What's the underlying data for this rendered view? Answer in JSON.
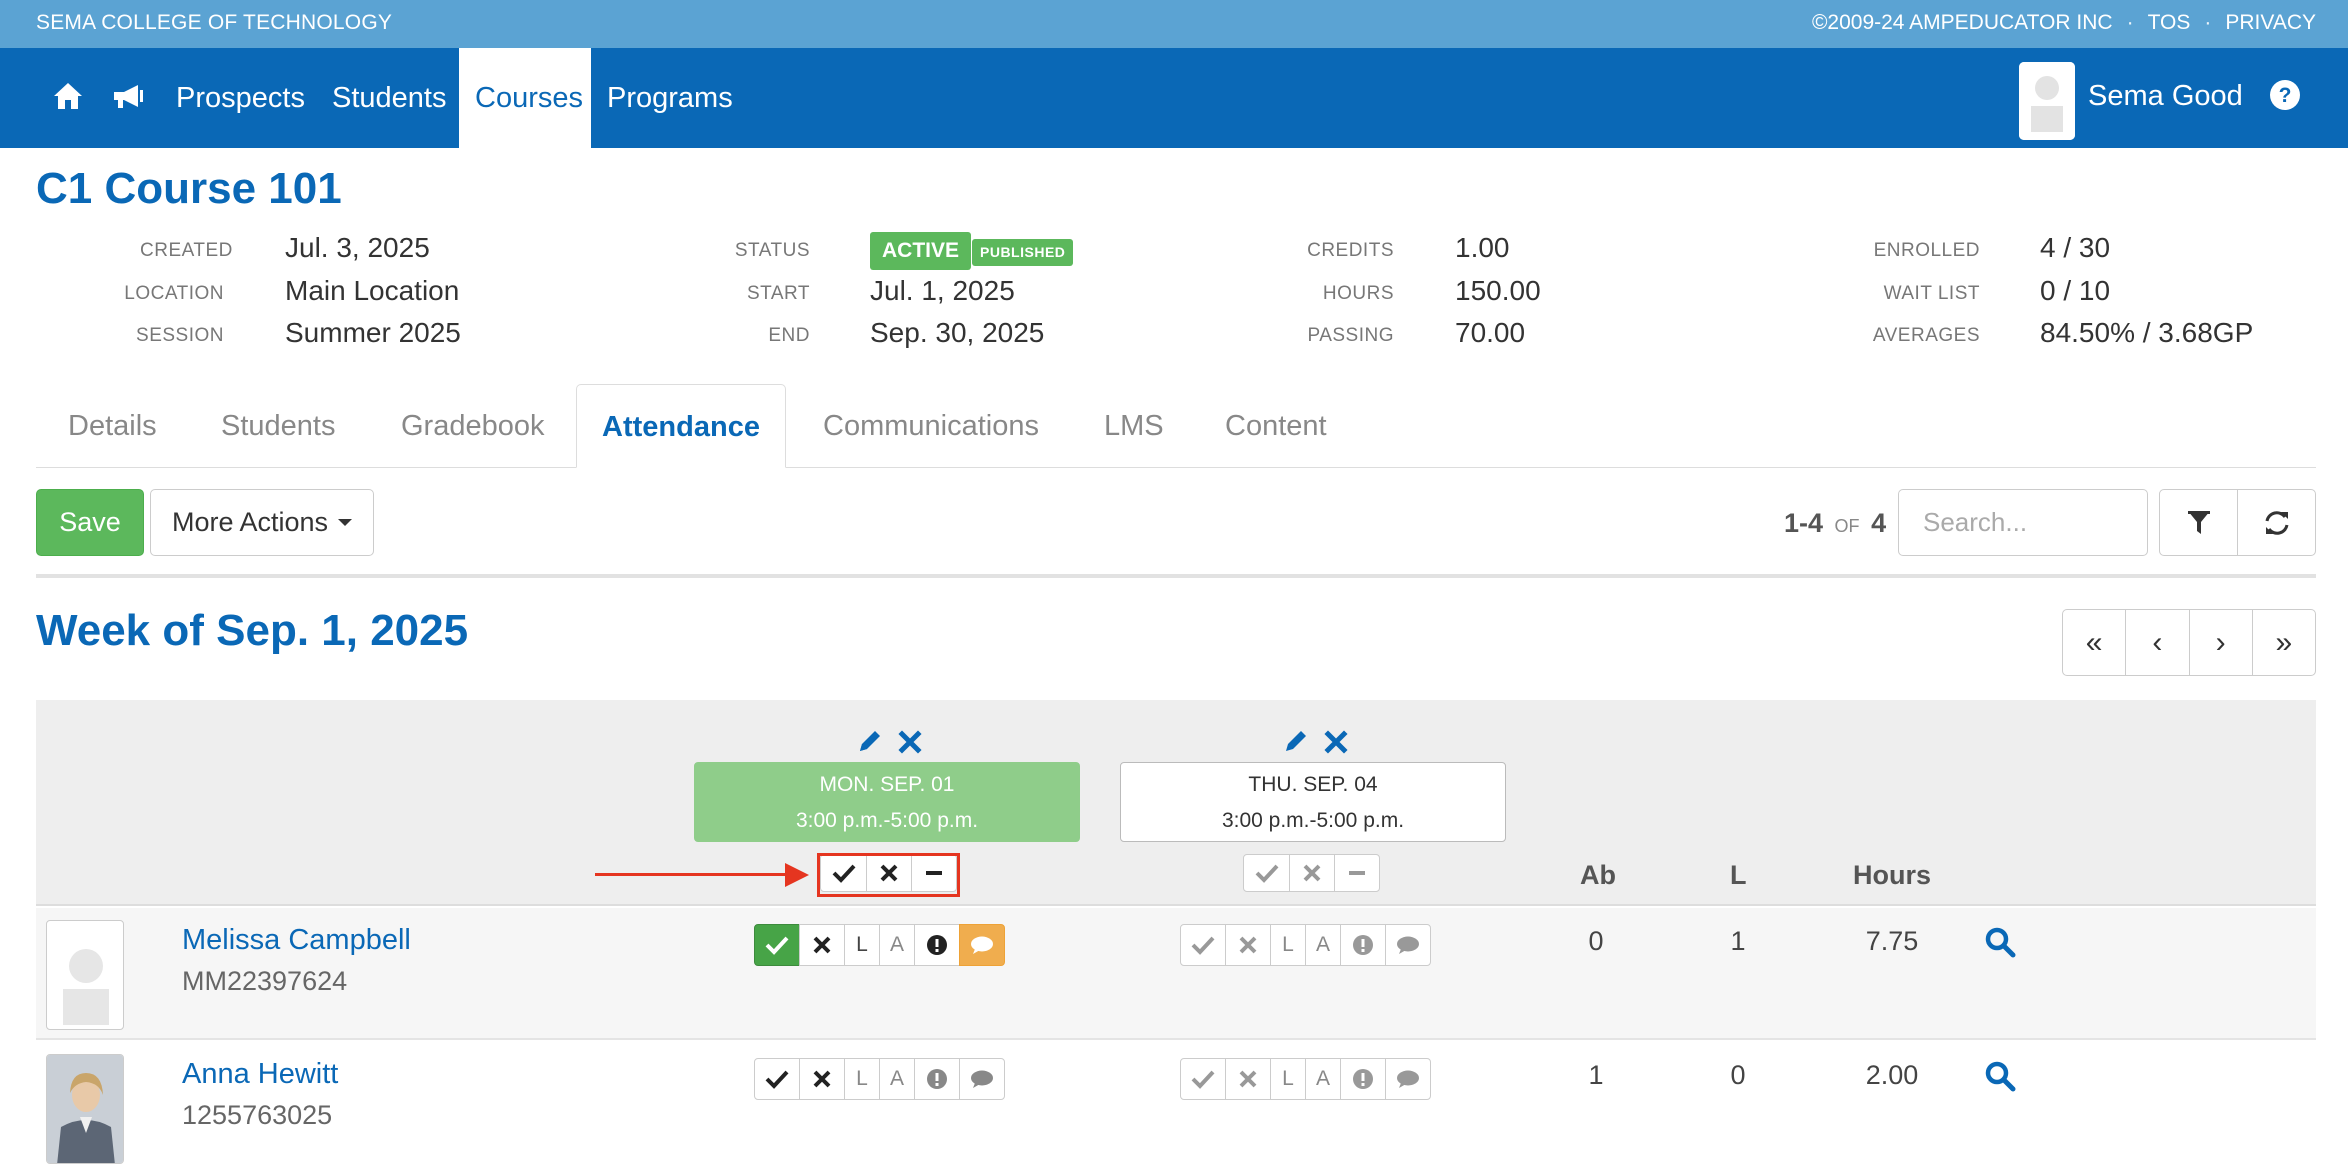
{
  "top_strip": {
    "school": "SEMA COLLEGE OF TECHNOLOGY",
    "copyright": "©2009-24 AMPEDUCATOR INC",
    "tos": "TOS",
    "privacy": "PRIVACY",
    "separator": "·"
  },
  "nav": {
    "home_icon": "home-icon",
    "announce_icon": "megaphone-icon",
    "links": [
      "Prospects",
      "Students",
      "Courses",
      "Programs"
    ],
    "active": "Courses",
    "user_name": "Sema Good",
    "help_icon": "question-circle-icon"
  },
  "course": {
    "title": "C1 Course 101",
    "meta": {
      "created_label": "CREATED",
      "created": "Jul. 3, 2025",
      "location_label": "LOCATION",
      "location": "Main Location",
      "session_label": "SESSION",
      "session": "Summer 2025",
      "status_label": "STATUS",
      "status": "ACTIVE",
      "published": "PUBLISHED",
      "start_label": "START",
      "start": "Jul. 1, 2025",
      "end_label": "END",
      "end": "Sep. 30, 2025",
      "credits_label": "CREDITS",
      "credits": "1.00",
      "hours_label": "HOURS",
      "hours": "150.00",
      "passing_label": "PASSING",
      "passing": "70.00",
      "enrolled_label": "ENROLLED",
      "enrolled": "4 / 30",
      "waitlist_label": "WAIT LIST",
      "waitlist": "0 / 10",
      "averages_label": "AVERAGES",
      "averages": "84.50% / 3.68GP"
    }
  },
  "tabs": [
    "Details",
    "Students",
    "Gradebook",
    "Attendance",
    "Communications",
    "LMS",
    "Content"
  ],
  "active_tab": "Attendance",
  "toolbar": {
    "save": "Save",
    "more_actions": "More Actions",
    "range": "1-4",
    "of": "OF",
    "total": "4",
    "search_placeholder": "Search..."
  },
  "week": {
    "title": "Week of Sep. 1, 2025",
    "nav": [
      "«",
      "‹",
      "›",
      "»"
    ]
  },
  "sessions": [
    {
      "day": "MON. SEP. 01",
      "time": "3:00 p.m.-5:00 p.m.",
      "selected": true
    },
    {
      "day": "THU. SEP. 04",
      "time": "3:00 p.m.-5:00 p.m.",
      "selected": false
    }
  ],
  "columns": {
    "absent": "Ab",
    "late": "L",
    "hours": "Hours"
  },
  "att_letters": {
    "late": "L",
    "absent": "A"
  },
  "students": [
    {
      "name": "Melissa Campbell",
      "id": "MM22397624",
      "ab": "0",
      "l": "1",
      "hours": "7.75",
      "mon_status": "present",
      "mon_comment": true
    },
    {
      "name": "Anna Hewitt",
      "id": "1255763025",
      "ab": "1",
      "l": "0",
      "hours": "2.00",
      "mon_status": "none",
      "mon_comment": false
    }
  ],
  "colors": {
    "brand": "#0a68b6",
    "top_strip": "#5ba3d3",
    "success": "#5cb85c",
    "session_selected": "#8fcd8a",
    "comment_active": "#f0ad4e",
    "annotation": "#e53520"
  }
}
